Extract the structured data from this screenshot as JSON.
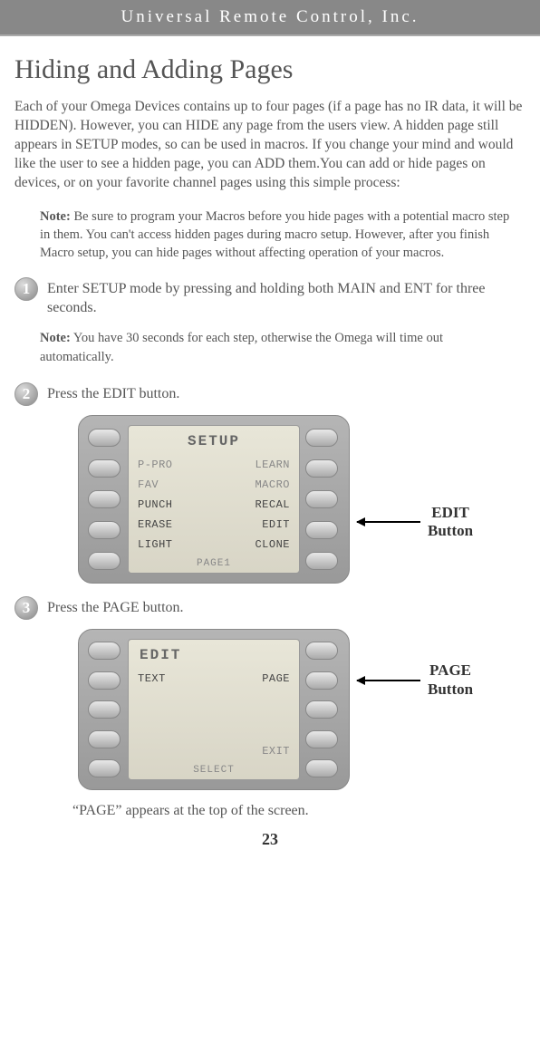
{
  "header": {
    "company": "Universal Remote Control, Inc."
  },
  "title": "Hiding and Adding Pages",
  "intro": "Each of your Omega Devices contains up to four pages (if a page has no IR data, it will be HIDDEN). However, you can HIDE any page from the users view. A hidden page still appears in SETUP modes, so can be used in macros. If you change your mind and would like the user to see a hidden page, you can ADD them.You can add or hide pages on devices, or on your favorite channel pages using this simple process:",
  "note1_label": "Note:",
  "note1_text": " Be sure to program your Macros before you hide pages with a potential macro step in them. You can't access hidden pages during macro setup. However, after you finish Macro setup, you can hide pages without affecting operation of your macros.",
  "step1_num": "1",
  "step1_text": "Enter SETUP mode by pressing and holding both MAIN and ENT for three seconds.",
  "note2_label": "Note:",
  "note2_text": " You have 30 seconds for each step, otherwise the Omega will time out automatically.",
  "step2_num": "2",
  "step2_text": "Press the EDIT button.",
  "fig1": {
    "screen_title": "SETUP",
    "rows": [
      {
        "l": "P-PRO",
        "r": "LEARN",
        "dark": false
      },
      {
        "l": "FAV",
        "r": "MACRO",
        "dark": false
      },
      {
        "l": "PUNCH",
        "r": "RECAL",
        "dark": true
      },
      {
        "l": "ERASE",
        "r": "EDIT",
        "dark": true
      },
      {
        "l": "LIGHT",
        "r": "CLONE",
        "dark": true
      }
    ],
    "footer": "PAGE1",
    "annotation": "EDIT\nButton"
  },
  "step3_num": "3",
  "step3_text": "Press the PAGE button.",
  "fig2": {
    "screen_title": "EDIT",
    "rows": [
      {
        "l": "TEXT",
        "r": "PAGE",
        "dark": true
      }
    ],
    "exit": "EXIT",
    "footer": "SELECT",
    "annotation": "PAGE\nButton"
  },
  "caption": "“PAGE” appears at the top of the screen.",
  "page_num": "23"
}
